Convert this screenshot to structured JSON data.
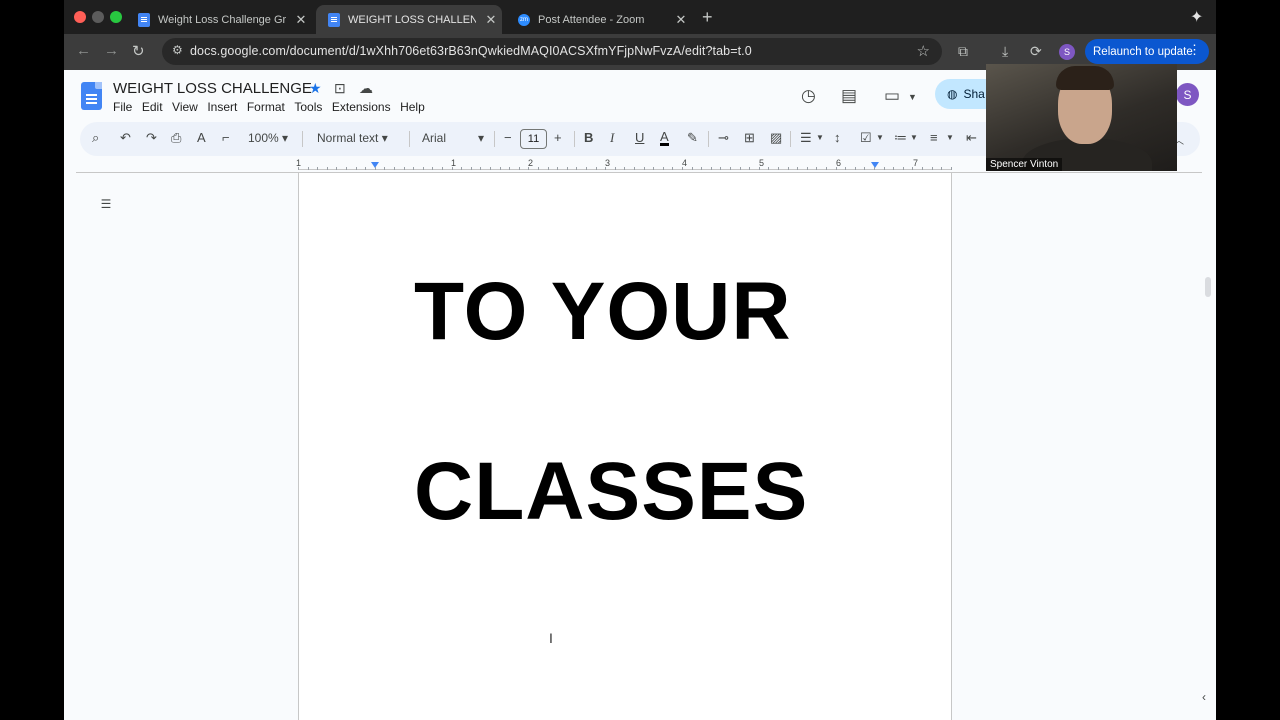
{
  "browser": {
    "tabs": [
      {
        "title": "Weight Loss Challenge Grail:",
        "icon": "google-docs-icon",
        "active": false
      },
      {
        "title": "WEIGHT LOSS CHALLENGE -",
        "icon": "google-docs-icon",
        "active": true
      },
      {
        "title": "Post Attendee - Zoom",
        "icon": "zoom-icon",
        "active": false
      }
    ],
    "url": "docs.google.com/document/d/1wXhh706et63rB63nQwkiedMAQI0ACSXfmYFjpNwFvzA/edit?tab=t.0",
    "relaunch_label": "Relaunch to update",
    "profile_initial": "S"
  },
  "docs": {
    "title": "WEIGHT LOSS CHALLENGE",
    "menu": [
      "File",
      "Edit",
      "View",
      "Insert",
      "Format",
      "Tools",
      "Extensions",
      "Help"
    ],
    "share_label": "Sha",
    "user_initial": "S",
    "toolbar": {
      "zoom": "100%",
      "style": "Normal text",
      "font": "Arial",
      "font_size": "11"
    },
    "ruler_numbers": [
      "1",
      "1",
      "2",
      "3",
      "4",
      "5",
      "6",
      "7"
    ],
    "content_lines": [
      "TO YOUR",
      "CLASSES"
    ]
  },
  "zoom_video": {
    "participant_name": "Spencer Vinton"
  },
  "colors": {
    "accent_blue": "#0b57d0",
    "share_bg": "#c2e7ff",
    "docs_blue": "#4285f4"
  }
}
